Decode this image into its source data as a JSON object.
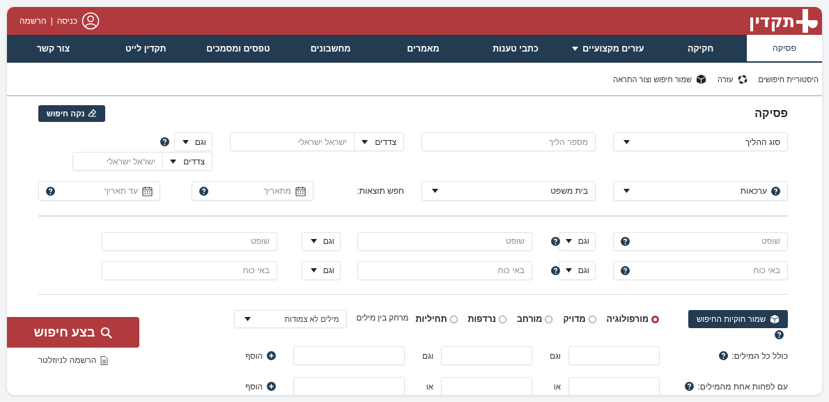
{
  "header": {
    "logo": "תקדין",
    "login": "כניסה",
    "separator": "|",
    "register": "הרשמה"
  },
  "nav": [
    {
      "label": "פסיקה",
      "selected": true,
      "dropdown": false
    },
    {
      "label": "חקיקה",
      "selected": false,
      "dropdown": false
    },
    {
      "label": "עזרים מקצועיים",
      "selected": false,
      "dropdown": true
    },
    {
      "label": "כתבי טענות",
      "selected": false,
      "dropdown": false
    },
    {
      "label": "מאמרים",
      "selected": false,
      "dropdown": false
    },
    {
      "label": "מחשבונים",
      "selected": false,
      "dropdown": false
    },
    {
      "label": "טפסים ומסמכים",
      "selected": false,
      "dropdown": false
    },
    {
      "label": "תקדין לייט",
      "selected": false,
      "dropdown": false
    },
    {
      "label": "צור קשר",
      "selected": false,
      "dropdown": false
    }
  ],
  "toolbar": [
    {
      "label": "היסטוריית חיפושים",
      "kind": "history"
    },
    {
      "label": "עזרה",
      "kind": "help"
    },
    {
      "label": "שמור חיפוש וצור התראה",
      "kind": "save"
    }
  ],
  "form": {
    "title": "פסיקה",
    "clear_button": "נקה חיפוש",
    "rows": [
      {
        "items": [
          {
            "kind": "select",
            "value": "סוג ההליך",
            "help": false
          },
          {
            "kind": "input",
            "placeholder": "מספר הליך",
            "help": false
          },
          {
            "kind": "parties",
            "value": "צדדים",
            "placeholder": "ישראל ישראלי"
          },
          {
            "kind": "and",
            "value": "וגם"
          },
          {
            "kind": "help"
          }
        ]
      },
      {
        "items": [
          {
            "kind": "parties",
            "value": "צדדים",
            "placeholder": "ישראל ישראלי"
          }
        ]
      },
      {
        "items": [
          {
            "kind": "select",
            "value": "ערכאות",
            "help": true
          },
          {
            "kind": "select",
            "value": "בית משפט",
            "help": false
          },
          {
            "kind": "label",
            "value": "חפש תוצאות:"
          },
          {
            "kind": "date",
            "placeholder": "מתאריך",
            "help": true
          },
          {
            "kind": "date",
            "placeholder": "עד תאריך",
            "help": true
          }
        ]
      },
      {
        "items": [
          {
            "kind": "input",
            "placeholder": "שופט",
            "help": true
          },
          {
            "kind": "and",
            "value": "וגם"
          },
          {
            "kind": "help"
          },
          {
            "kind": "input",
            "placeholder": "שופט",
            "help": false
          },
          {
            "kind": "and",
            "value": "וגם"
          },
          {
            "kind": "input",
            "placeholder": "שופט",
            "help": false
          }
        ]
      },
      {
        "items": [
          {
            "kind": "input",
            "placeholder": "באי כוח",
            "help": true
          },
          {
            "kind": "and",
            "value": "וגם"
          },
          {
            "kind": "help"
          },
          {
            "kind": "input",
            "placeholder": "באי כוח",
            "help": false
          },
          {
            "kind": "and",
            "value": "וגם"
          },
          {
            "kind": "input",
            "placeholder": "באי כוח",
            "help": false
          }
        ]
      }
    ],
    "save_rules_button": "שמור חוקיות החיפוש",
    "match_modes": [
      {
        "label": "מורפולוגיה",
        "selected": true
      },
      {
        "label": "מדויק",
        "selected": false
      },
      {
        "label": "מורחב",
        "selected": false
      },
      {
        "label": "נרדפות",
        "selected": false
      },
      {
        "label": "תחיליות",
        "selected": false
      }
    ],
    "distance_label": "מרחק בין מילים",
    "distance_select": "מילים לא צמודות",
    "word_rows": [
      {
        "label": "כולל כל המילים:",
        "connectors": [
          "וגם",
          "וגם"
        ],
        "add": "הוסף"
      },
      {
        "label": "עם לפחות אחת מהמילים:",
        "connectors": [
          "או",
          "או"
        ],
        "add": "הוסף"
      }
    ]
  },
  "search_button": "בצע חיפוש",
  "newsletter": "הרשמה לניוזלטר"
}
